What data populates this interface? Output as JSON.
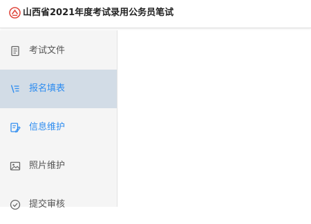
{
  "header": {
    "title": "山西省2021年度考试录用公务员笔试",
    "logo_icon": "emblem-icon",
    "brand_color": "#e0483e"
  },
  "sidebar": {
    "items": [
      {
        "label": "考试文件",
        "icon": "document-icon",
        "state": "normal"
      },
      {
        "label": "报名填表",
        "icon": "form-icon",
        "state": "active"
      },
      {
        "label": "信息维护",
        "icon": "edit-icon",
        "state": "highlight"
      },
      {
        "label": "照片维护",
        "icon": "image-icon",
        "state": "normal"
      },
      {
        "label": "提交审核",
        "icon": "check-circle-icon",
        "state": "normal"
      }
    ],
    "active_bg": "#d2dce6",
    "accent": "#2d8cf0"
  }
}
